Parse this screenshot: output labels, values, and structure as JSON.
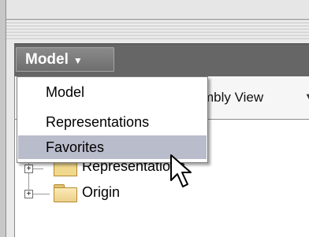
{
  "header": {
    "model_button_label": "Model",
    "model_button_caret": "▼"
  },
  "tab": {
    "visible_label": "mbly View",
    "caret": "▼"
  },
  "menu": {
    "items": [
      {
        "label": "Model"
      },
      {
        "label": "Representations"
      },
      {
        "label": "Favorites"
      }
    ],
    "highlighted_index": 2
  },
  "tree": {
    "rows": [
      {
        "label": "Representations",
        "expander": "+"
      },
      {
        "label": "Origin",
        "expander": "+"
      }
    ]
  },
  "icons": {
    "cursor": "arrow-cursor-icon",
    "folder": "folder-icon",
    "representations": "representations-icon",
    "expand": "expand-plus-icon"
  },
  "colors": {
    "header_bar": "#666666",
    "menu_highlight": "#b9bccb",
    "folder": "#f1d68c"
  }
}
